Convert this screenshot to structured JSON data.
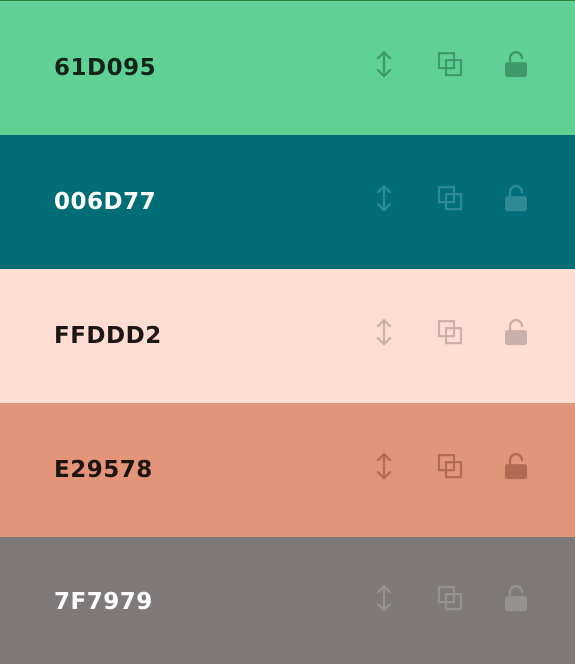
{
  "palette": {
    "colors": [
      {
        "hex": "61D095",
        "background": "#61D095",
        "text_color": "#13251b",
        "icon_color": "#3f9a69"
      },
      {
        "hex": "006D77",
        "background": "#006D77",
        "text_color": "#ffffff",
        "icon_color": "#2f8a93"
      },
      {
        "hex": "FFDDD2",
        "background": "#FFDDD2",
        "text_color": "#1c1614",
        "icon_color": "#c9b0a8"
      },
      {
        "hex": "E29578",
        "background": "#E29578",
        "text_color": "#1e130f",
        "icon_color": "#b46a52"
      },
      {
        "hex": "7F7979",
        "background": "#7F7979",
        "text_color": "#ffffff",
        "icon_color": "#969191"
      }
    ],
    "icons": [
      "drag-vertical-icon",
      "copy-icon",
      "unlock-icon"
    ]
  }
}
